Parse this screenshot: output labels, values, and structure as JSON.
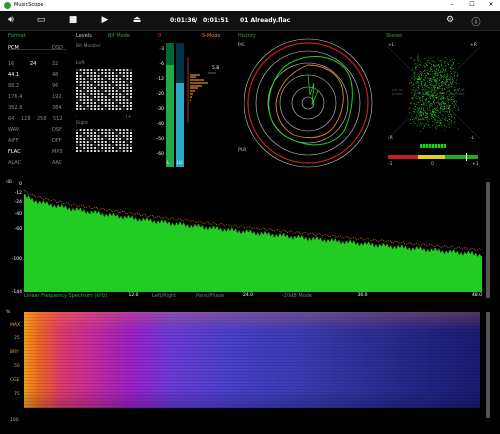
{
  "app": {
    "title": "MusicScope"
  },
  "window_controls": {
    "minimize": "–",
    "maximize": "☐",
    "close": "✕"
  },
  "toolbar": {
    "time_current": "0:01:36",
    "time_separator": "/",
    "time_total": "0:01:51",
    "track": "01 Already.flac"
  },
  "format": {
    "title": "Format",
    "left_col": [
      "PCM",
      "16",
      "44.1",
      "88.2",
      "176.4",
      "352.8",
      "",
      "WAV",
      "AIFF",
      "FLAC",
      "ALAC"
    ],
    "right_col": [
      "DSD",
      "32",
      "48",
      "96",
      "192",
      "384",
      "",
      "DSF",
      "DFF",
      "MP3",
      "AAC"
    ],
    "bits_24": "24",
    "bits_row": [
      "64",
      "128",
      "256",
      "512"
    ],
    "active": [
      "PCM",
      "24",
      "44.1",
      "FLAC"
    ]
  },
  "levels": {
    "title": "Levels",
    "mode": "Bit Mode",
    "bit_monitor": "Bit Monitor",
    "left": "Left",
    "right": "Right",
    "scale_min": "-",
    "scale_max": "[+"
  },
  "meters": {
    "top_left": "0",
    "top_right": "S-Mode",
    "scale": [
      "-3",
      "-6",
      "-12",
      "-20",
      "-30",
      "-40",
      "-50",
      "-60"
    ],
    "peak_value": "5.8",
    "bottom_left": "L",
    "bottom_right": "LU",
    "left_level_pct": 82,
    "right_level_pct": 68
  },
  "history": {
    "title": "History",
    "top": "P/L",
    "bottom": "PLR"
  },
  "stereo": {
    "title": "Stereo",
    "plus_l": "+L",
    "plus_r": "+R",
    "minus_l": "-L",
    "minus_r": "-R",
    "note_left": "out of phase",
    "note_right": "out of phase",
    "corr_left": "-1",
    "corr_mid": "0",
    "corr_right": "+1",
    "correlation": 0.65
  },
  "spectrum": {
    "y_unit": "dB",
    "y_labels": [
      "0",
      "-12",
      "-24",
      "-40",
      "-60",
      "-100",
      "-144"
    ],
    "x_labels": [
      "12.0",
      "24.0",
      "36.0",
      "48.0"
    ],
    "bottom_legend": [
      "Linear Frequency Spectrum (kHz)",
      "Left/Right",
      "Pans/Phase",
      "-20dB Mode"
    ],
    "max_khz": 48
  },
  "spectrogram": {
    "y_unit": "%",
    "labels": [
      "MAX",
      "25",
      "BRY",
      "50",
      "CGE",
      "75"
    ],
    "bottom": "100"
  },
  "colors": {
    "accent_green": "#2ea84a",
    "spectrum_fill": "#22cc22",
    "peak_line": "#e08a1a",
    "meter_left": "#22aa44",
    "meter_right": "#2aa8c8"
  }
}
